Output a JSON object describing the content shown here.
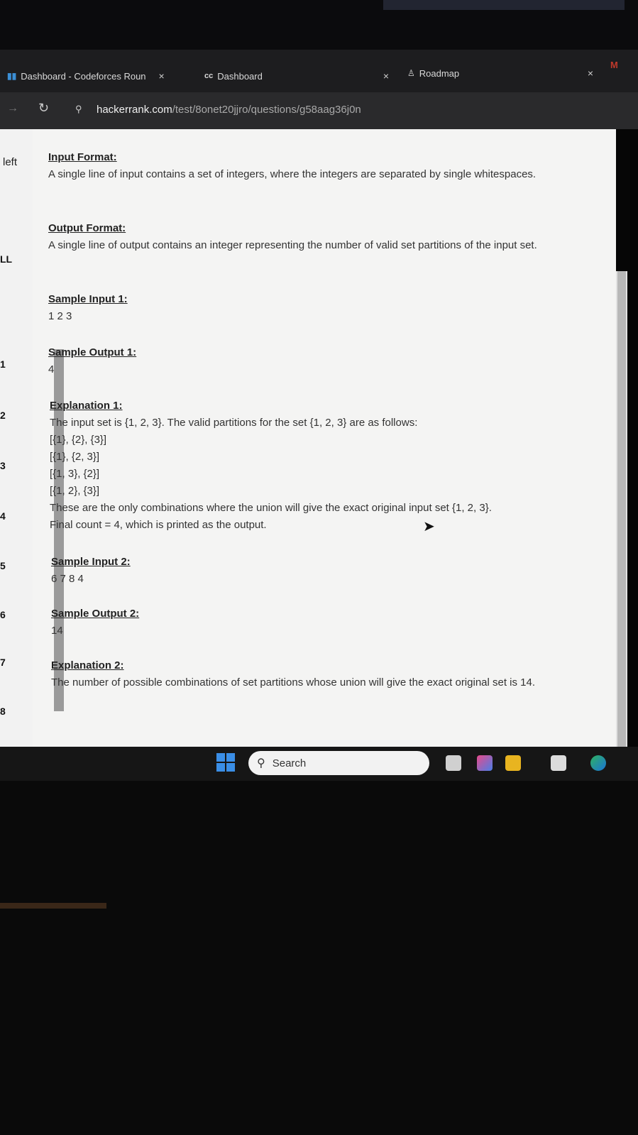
{
  "tabs": [
    {
      "label": "Dashboard - Codeforces Roun",
      "close": "×"
    },
    {
      "label": "Dashboard",
      "prefix": "cc",
      "close": "×"
    },
    {
      "label": "Roadmap",
      "close": "×"
    }
  ],
  "address_bar": {
    "host": "hackerrank.com",
    "path": "/test/8onet20jjro/questions/g58aag36j0n"
  },
  "side_panel": {
    "left_label": "left",
    "numbers": [
      "LL",
      "1",
      "2",
      "3",
      "4",
      "5",
      "6",
      "7",
      "8"
    ]
  },
  "problem": {
    "input_format": {
      "heading": "Input Format:",
      "text": "A single line of input contains a set of integers, where the integers are separated by single whitespaces."
    },
    "output_format": {
      "heading": "Output Format:",
      "text": "A single line of output contains an integer representing the number of valid set partitions of the input set."
    },
    "sample_input_1": {
      "heading": "Sample Input 1:",
      "value": "1 2 3"
    },
    "sample_output_1": {
      "heading": "Sample Output 1:",
      "value": "4"
    },
    "explanation_1": {
      "heading": "Explanation 1:",
      "intro": "The input set is {1, 2, 3}. The valid partitions for the set {1, 2, 3} are as follows:",
      "partitions": [
        "[{1}, {2}, {3}]",
        "[{1}, {2, 3}]",
        "[{1, 3}, {2}]",
        "[{1, 2}, {3}]"
      ],
      "line1": "These are the only combinations where the union will give the exact original input set {1, 2, 3}.",
      "line2": "Final count = 4, which is printed as the output."
    },
    "sample_input_2": {
      "heading": "Sample Input 2:",
      "value": "6 7 8 4"
    },
    "sample_output_2": {
      "heading": "Sample Output 2:",
      "value": "14"
    },
    "explanation_2": {
      "heading": "Explanation 2:",
      "text": "The number of possible combinations of set partitions whose union will give the exact original set is 14."
    }
  },
  "taskbar": {
    "search_label": "Search"
  }
}
